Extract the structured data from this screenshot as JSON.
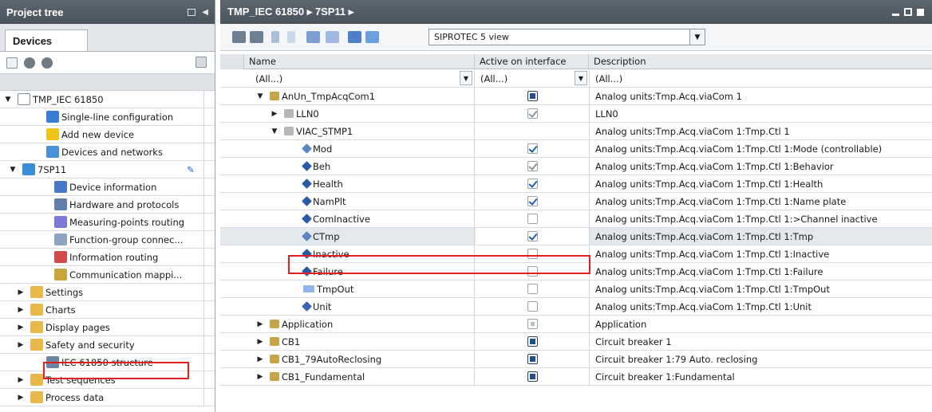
{
  "left_pane": {
    "title": "Project tree",
    "tab": "Devices",
    "tree": [
      {
        "label": "TMP_IEC 61850",
        "expanded": true,
        "icon": "project-icon"
      },
      {
        "label": "Single-line configuration",
        "icon": "single-line-icon"
      },
      {
        "label": "Add new device",
        "icon": "add-device-icon"
      },
      {
        "label": "Devices and networks",
        "icon": "network-icon"
      },
      {
        "label": "7SP11",
        "expanded": true,
        "icon": "device-icon"
      },
      {
        "label": "Device information",
        "icon": "info-icon"
      },
      {
        "label": "Hardware and protocols",
        "icon": "hardware-icon"
      },
      {
        "label": "Measuring-points routing",
        "icon": "measuring-icon"
      },
      {
        "label": "Function-group connec...",
        "icon": "function-group-icon"
      },
      {
        "label": "Information routing",
        "icon": "information-routing-icon"
      },
      {
        "label": "Communication mappi...",
        "icon": "communication-icon"
      },
      {
        "label": "Settings",
        "icon": "settings-folder-icon"
      },
      {
        "label": "Charts",
        "icon": "charts-folder-icon"
      },
      {
        "label": "Display pages",
        "icon": "display-folder-icon"
      },
      {
        "label": "Safety and security",
        "icon": "safety-folder-icon"
      },
      {
        "label": "IEC 61850 structure",
        "icon": "iec-structure-icon"
      },
      {
        "label": "Test sequences",
        "icon": "test-folder-icon"
      },
      {
        "label": "Process data",
        "icon": "process-folder-icon"
      }
    ]
  },
  "right_pane": {
    "breadcrumb": "TMP_IEC 61850 ▸ 7SP11 ▸",
    "view_select": "SIPROTEC 5 view",
    "columns": {
      "name": "Name",
      "active": "Active on interface",
      "description": "Description"
    },
    "filter": {
      "name": "(All...)",
      "active": "(All...)",
      "description": "(All...)"
    },
    "rows": [
      {
        "name": "AnUn_TmpAcqCom1",
        "state": "filled",
        "description": "Analog units:Tmp.Acq.viaCom 1"
      },
      {
        "name": "LLN0",
        "state": "checked-gray",
        "description": "LLN0"
      },
      {
        "name": "VIAC_STMP1",
        "state": "none",
        "description": "Analog units:Tmp.Acq.viaCom 1:Tmp.Ctl 1"
      },
      {
        "name": "Mod",
        "state": "checked",
        "description": "Analog units:Tmp.Acq.viaCom 1:Tmp.Ctl 1:Mode (controllable)"
      },
      {
        "name": "Beh",
        "state": "checked-gray",
        "description": "Analog units:Tmp.Acq.viaCom 1:Tmp.Ctl 1:Behavior"
      },
      {
        "name": "Health",
        "state": "checked",
        "description": "Analog units:Tmp.Acq.viaCom 1:Tmp.Ctl 1:Health"
      },
      {
        "name": "NamPlt",
        "state": "checked",
        "description": "Analog units:Tmp.Acq.viaCom 1:Tmp.Ctl 1:Name plate"
      },
      {
        "name": "ComInactive",
        "state": "unchecked",
        "description": "Analog units:Tmp.Acq.viaCom 1:Tmp.Ctl 1:>Channel inactive"
      },
      {
        "name": "CTmp",
        "state": "checked",
        "description": "Analog units:Tmp.Acq.viaCom 1:Tmp.Ctl 1:Tmp"
      },
      {
        "name": "Inactive",
        "state": "unchecked",
        "description": "Analog units:Tmp.Acq.viaCom 1:Tmp.Ctl 1:Inactive"
      },
      {
        "name": "Failure",
        "state": "unchecked",
        "description": "Analog units:Tmp.Acq.viaCom 1:Tmp.Ctl 1:Failure"
      },
      {
        "name": "TmpOut",
        "state": "unchecked",
        "description": "Analog units:Tmp.Acq.viaCom 1:Tmp.Ctl 1:TmpOut"
      },
      {
        "name": "Unit",
        "state": "unchecked",
        "description": "Analog units:Tmp.Acq.viaCom 1:Tmp.Ctl 1:Unit"
      },
      {
        "name": "Application",
        "state": "dim",
        "description": "Application"
      },
      {
        "name": "CB1",
        "state": "filled",
        "description": "Circuit breaker 1"
      },
      {
        "name": "CB1_79AutoReclosing",
        "state": "filled",
        "description": "Circuit breaker 1:79 Auto. reclosing"
      },
      {
        "name": "CB1_Fundamental",
        "state": "filled",
        "description": "Circuit breaker 1:Fundamental"
      }
    ]
  },
  "colors": {
    "title_bar": "#4f5a63",
    "highlight": "#e02020",
    "accent": "#1f4f8f"
  }
}
